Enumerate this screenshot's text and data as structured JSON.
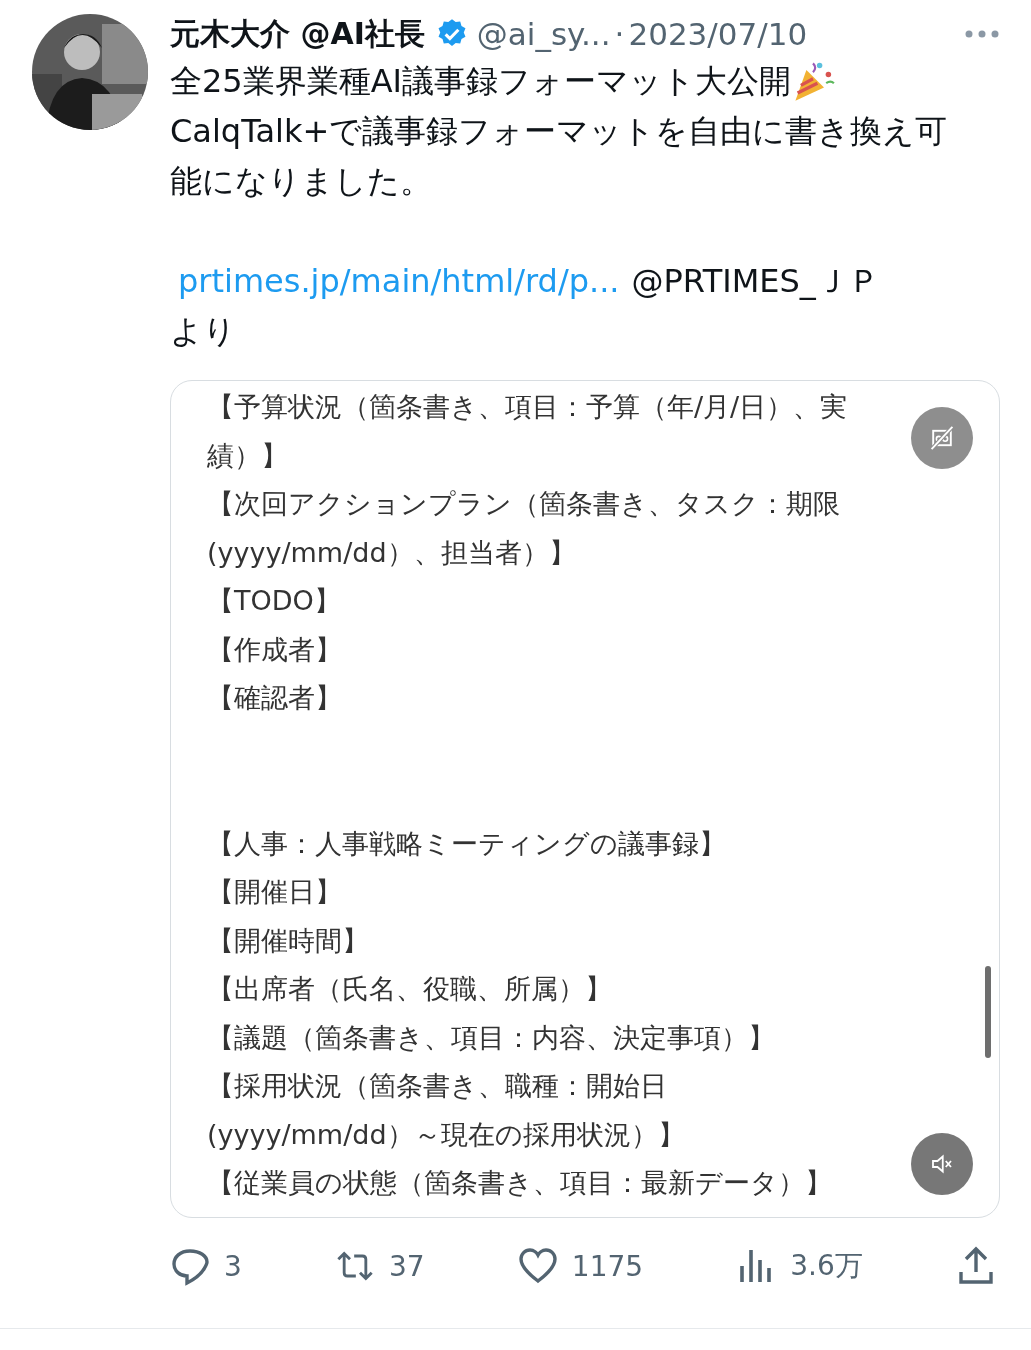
{
  "tweet": {
    "author_name": "元木大介 @AI社長",
    "verified": true,
    "handle": "@ai_sy...",
    "separator": "·",
    "date": "2023/07/10",
    "paragraphs": [
      "全25業界業種AI議事録フォーマット大公開",
      "CalqTalk+で議事録フォーマットを自由に書き換え可能になりました。"
    ],
    "link": "prtimes.jp/main/html/rd/p...",
    "mention": "@PRTIMES_ＪＰ",
    "link_suffix": "より"
  },
  "video": {
    "sections": [
      {
        "lines": [
          "【予算状況（箇条書き、項目：予算（年/月/日）、実",
          "績）】",
          "【次回アクションプラン（箇条書き、タスク：期限",
          "(yyyy/mm/dd）、担当者）】",
          "【TODO】",
          "【作成者】",
          "【確認者】"
        ]
      },
      {
        "lines": [
          "【人事：人事戦略ミーティングの議事録】",
          "【開催日】",
          "【開催時間】",
          "【出席者（氏名、役職、所属）】",
          "【議題（箇条書き、項目：内容、決定事項）】",
          "【採用状況（箇条書き、職種：開始日",
          "(yyyy/mm/dd）～現在の採用状況）】",
          "【従業員の状態（箇条書き、項目：最新データ）】"
        ]
      }
    ],
    "captions_on": false,
    "muted": true
  },
  "actions": [
    {
      "kind": "reply",
      "count": "3"
    },
    {
      "kind": "retweet",
      "count": "37"
    },
    {
      "kind": "like",
      "count": "1175"
    },
    {
      "kind": "views",
      "count": "3.6万"
    },
    {
      "kind": "share"
    }
  ]
}
